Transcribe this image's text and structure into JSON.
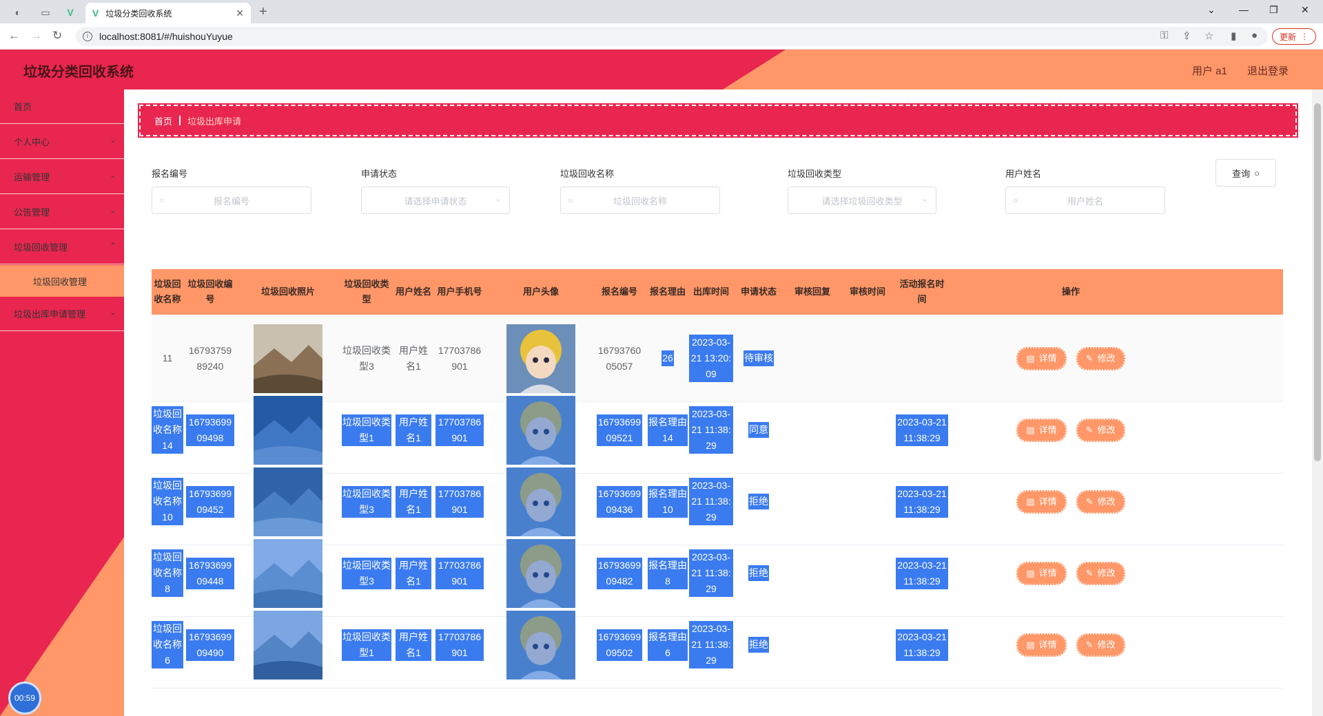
{
  "browser": {
    "tab_title": "垃圾分类回收系统",
    "url": "localhost:8081/#/huishouYuyue",
    "update_label": "更新"
  },
  "header": {
    "title": "垃圾分类回收系统",
    "user": "用户 a1",
    "logout": "退出登录"
  },
  "sidebar": {
    "items": [
      {
        "label": "首页"
      },
      {
        "label": "个人中心"
      },
      {
        "label": "运输管理"
      },
      {
        "label": "公告管理"
      },
      {
        "label": "垃圾回收管理"
      },
      {
        "label": "垃圾出库申请管理"
      }
    ],
    "submenu": {
      "label": "垃圾回收管理"
    },
    "timer": "00:59"
  },
  "breadcrumb": {
    "home": "首页",
    "current": "垃圾出库申请"
  },
  "filters": {
    "baoming_label": "报名编号",
    "baoming_placeholder": "报名编号",
    "status_label": "申请状态",
    "status_placeholder": "请选择申请状态",
    "name_label": "垃圾回收名称",
    "name_placeholder": "垃圾回收名称",
    "type_label": "垃圾回收类型",
    "type_placeholder": "请选择垃圾回收类型",
    "user_label": "用户姓名",
    "user_placeholder": "用户姓名",
    "query_button": "查询"
  },
  "table": {
    "headers": [
      "垃圾回收名称",
      "垃圾回收编号",
      "垃圾回收照片",
      "垃圾回收类型",
      "用户姓名",
      "用户手机号",
      "用户头像",
      "报名编号",
      "报名理由",
      "出库时间",
      "申请状态",
      "审核回复",
      "审核时间",
      "活动报名时间",
      "操作"
    ],
    "detail_label": "详情",
    "edit_label": "修改",
    "rows": [
      {
        "name": "11",
        "code": "1679375989240",
        "type": "垃圾回收类型3",
        "user": "用户姓名1",
        "phone": "17703786901",
        "bm_code": "1679376005057",
        "reason": "26",
        "out_time": "2023-03-21 13:20:09",
        "status": "待审核",
        "reply": "",
        "audit_time": "",
        "act_time": ""
      },
      {
        "name": "垃圾回收名称14",
        "code": "1679369909498",
        "type": "垃圾回收类型1",
        "user": "用户姓名1",
        "phone": "17703786901",
        "bm_code": "1679369909521",
        "reason": "报名理由14",
        "out_time": "2023-03-21 11:38:29",
        "status": "同意",
        "reply": "",
        "audit_time": "",
        "act_time": "2023-03-21 11:38:29"
      },
      {
        "name": "垃圾回收名称10",
        "code": "1679369909452",
        "type": "垃圾回收类型3",
        "user": "用户姓名1",
        "phone": "17703786901",
        "bm_code": "1679369909436",
        "reason": "报名理由10",
        "out_time": "2023-03-21 11:38:29",
        "status": "拒绝",
        "reply": "",
        "audit_time": "",
        "act_time": "2023-03-21 11:38:29"
      },
      {
        "name": "垃圾回收名称8",
        "code": "1679369909448",
        "type": "垃圾回收类型3",
        "user": "用户姓名1",
        "phone": "17703786901",
        "bm_code": "1679369909482",
        "reason": "报名理由8",
        "out_time": "2023-03-21 11:38:29",
        "status": "拒绝",
        "reply": "",
        "audit_time": "",
        "act_time": "2023-03-21 11:38:29"
      },
      {
        "name": "垃圾回收名称6",
        "code": "1679369909490",
        "type": "垃圾回收类型1",
        "user": "用户姓名1",
        "phone": "17703786901",
        "bm_code": "1679369909502",
        "reason": "报名理由6",
        "out_time": "2023-03-21 11:38:29",
        "status": "拒绝",
        "reply": "",
        "audit_time": "",
        "act_time": "2023-03-21 11:38:29"
      }
    ]
  }
}
